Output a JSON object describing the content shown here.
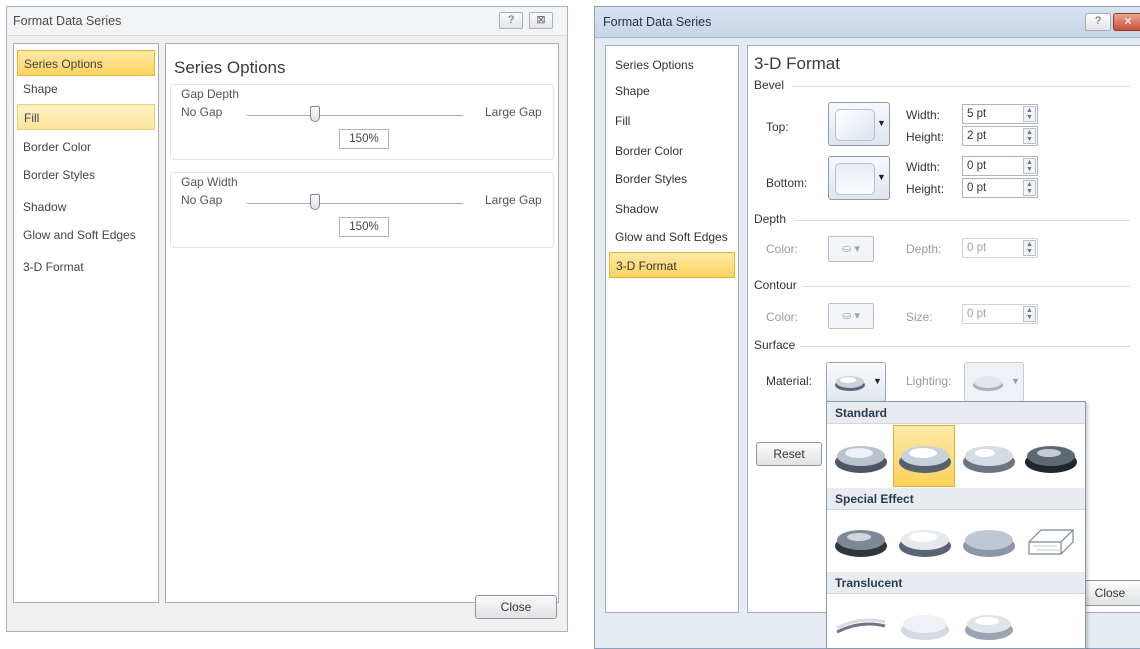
{
  "left_dialog": {
    "title": "Format Data Series",
    "help_icon": "?",
    "close_icon": "⊠",
    "nav": [
      "Series Options",
      "Shape",
      "Fill",
      "Border Color",
      "Border Styles",
      "Shadow",
      "Glow and Soft Edges",
      "3-D Format"
    ],
    "heading": "Series Options",
    "gap_depth": {
      "label": "Gap Depth",
      "min_label": "No Gap",
      "max_label": "Large Gap",
      "value": "150%"
    },
    "gap_width": {
      "label": "Gap Width",
      "min_label": "No Gap",
      "max_label": "Large Gap",
      "value": "150%"
    },
    "close_button": "Close"
  },
  "right_dialog": {
    "title": "Format Data Series",
    "help_icon": "?",
    "nav": [
      "Series Options",
      "Shape",
      "Fill",
      "Border Color",
      "Border Styles",
      "Shadow",
      "Glow and Soft Edges",
      "3-D Format"
    ],
    "heading": "3-D Format",
    "bevel": {
      "section": "Bevel",
      "top_label": "Top:",
      "bottom_label": "Bottom:",
      "width_label": "Width:",
      "height_label": "Height:",
      "top_width": "5 pt",
      "top_height": "2 pt",
      "bottom_width": "0 pt",
      "bottom_height": "0 pt"
    },
    "depth": {
      "section": "Depth",
      "color_label": "Color:",
      "depth_label": "Depth:",
      "depth_value": "0 pt"
    },
    "contour": {
      "section": "Contour",
      "color_label": "Color:",
      "size_label": "Size:",
      "size_value": "0 pt"
    },
    "surface": {
      "section": "Surface",
      "material_label": "Material:",
      "lighting_label": "Lighting:"
    },
    "reset_button": "Reset",
    "close_button": "Close",
    "gallery": {
      "sections": [
        "Standard",
        "Special Effect",
        "Translucent"
      ]
    }
  }
}
